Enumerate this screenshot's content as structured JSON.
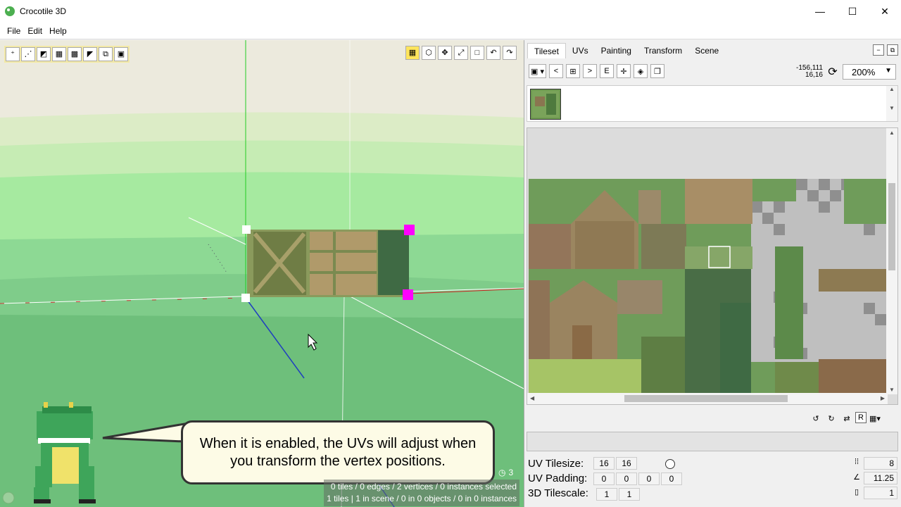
{
  "window": {
    "title": "Crocotile 3D",
    "minimize": "—",
    "maximize": "☐",
    "close": "✕"
  },
  "menu": [
    "File",
    "Edit",
    "Help"
  ],
  "viewport": {
    "left_tools": [
      "vertex-mode",
      "edge-mode",
      "face-mode",
      "paint-mode",
      "fill-mode",
      "eyedrop-mode",
      "clone-mode",
      "select-mode"
    ],
    "right_tools": [
      "grid-toggle",
      "cube-view",
      "move-tool",
      "rotate-tool",
      "square-tool",
      "undo",
      "redo"
    ],
    "callout_line1": "When it is enabled, the UVs will adjust when",
    "callout_line2": "you transform the vertex positions.",
    "clock_count": "3",
    "status_line1": "0 tiles / 0 edges / 2 vertices / 0 instances selected",
    "status_line2": "1 tiles | 1 in scene / 0 in 0 objects / 0 in 0 instances"
  },
  "panel": {
    "tabs": [
      "Tileset",
      "UVs",
      "Painting",
      "Transform",
      "Scene"
    ],
    "active_tab": "Tileset",
    "coords_line1": "-156,111",
    "coords_line2": "16,16",
    "zoom": "200%",
    "ts_buttons": [
      "<",
      ">",
      "E"
    ],
    "uv_tilesize_label": "UV Tilesize:",
    "uv_padding_label": "UV Padding:",
    "tilescale_label": "3D Tilescale:",
    "uv_tilesize": [
      "16",
      "16"
    ],
    "uv_padding": [
      "0",
      "0",
      "0",
      "0"
    ],
    "tilescale": [
      "1",
      "1"
    ],
    "right_values": [
      "8",
      "11.25",
      "1"
    ]
  },
  "colors": {
    "sky": "#eceadd",
    "ground": "#6ebf7b",
    "accent": "#ff00ff",
    "callout_bg": "#fdfbe6"
  }
}
